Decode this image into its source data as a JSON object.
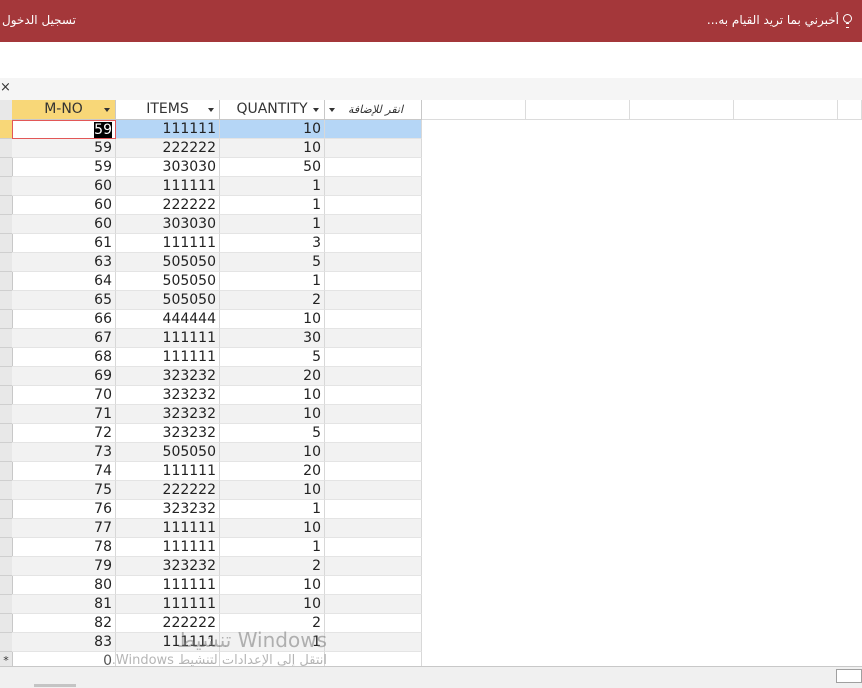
{
  "ribbon": {
    "tell_me": "أخبرني بما تريد القيام به...",
    "sign_in": "تسجيل الدخول",
    "color": "#a4373a"
  },
  "document": {
    "close_symbol": "×"
  },
  "table": {
    "columns": [
      {
        "label": "M-NO"
      },
      {
        "label": "ITEMS"
      },
      {
        "label": "QUANTITY"
      },
      {
        "label": "انقر للإضافة"
      }
    ],
    "rows": [
      [
        "59",
        "111111",
        "10"
      ],
      [
        "59",
        "222222",
        "10"
      ],
      [
        "59",
        "303030",
        "50"
      ],
      [
        "60",
        "111111",
        "1"
      ],
      [
        "60",
        "222222",
        "1"
      ],
      [
        "60",
        "303030",
        "1"
      ],
      [
        "61",
        "111111",
        "3"
      ],
      [
        "63",
        "505050",
        "5"
      ],
      [
        "64",
        "505050",
        "1"
      ],
      [
        "65",
        "505050",
        "2"
      ],
      [
        "66",
        "444444",
        "10"
      ],
      [
        "67",
        "111111",
        "30"
      ],
      [
        "68",
        "111111",
        "5"
      ],
      [
        "69",
        "323232",
        "20"
      ],
      [
        "70",
        "323232",
        "10"
      ],
      [
        "71",
        "323232",
        "10"
      ],
      [
        "72",
        "323232",
        "5"
      ],
      [
        "73",
        "505050",
        "10"
      ],
      [
        "74",
        "111111",
        "20"
      ],
      [
        "75",
        "222222",
        "10"
      ],
      [
        "76",
        "323232",
        "1"
      ],
      [
        "77",
        "111111",
        "10"
      ],
      [
        "78",
        "111111",
        "1"
      ],
      [
        "79",
        "323232",
        "2"
      ],
      [
        "80",
        "111111",
        "10"
      ],
      [
        "81",
        "111111",
        "10"
      ],
      [
        "82",
        "222222",
        "2"
      ],
      [
        "83",
        "111111",
        "1"
      ]
    ],
    "new_row": {
      "marker": "*",
      "value": "0"
    },
    "selected_row_color": "#b5d6f6",
    "header_selected_color": "#f8d778"
  },
  "watermark": {
    "line1": "تنشيط Windows",
    "line2": "انتقل إلى الإعدادات لتنشيط Windows."
  }
}
